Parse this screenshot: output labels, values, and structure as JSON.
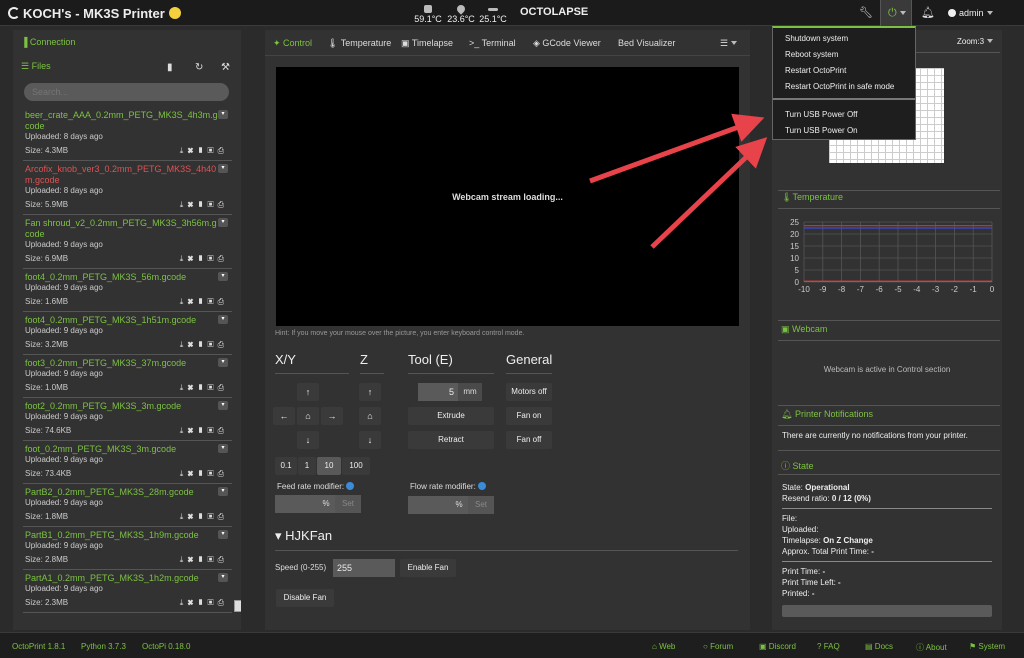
{
  "navbar": {
    "title": "KOCH's - MK3S Printer",
    "temps": [
      {
        "icon": "thermometer-icon",
        "value": "59.1°C"
      },
      {
        "icon": "droplet-icon",
        "value": "23.6°C"
      },
      {
        "icon": "bed-icon",
        "value": "25.1°C"
      }
    ],
    "octolapse": "OCTOLAPSE",
    "user": "admin",
    "icons": [
      "wrench-icon",
      "power-icon",
      "bell-icon",
      "user-icon"
    ]
  },
  "power_menu": {
    "items": [
      "Shutdown system",
      "Reboot system",
      "Restart OctoPrint",
      "Restart OctoPrint in safe mode",
      "Turn USB Power Off",
      "Turn USB Power On"
    ]
  },
  "sidebar": {
    "connection": "Connection",
    "files": "Files",
    "search_placeholder": "Search...",
    "file_list": [
      {
        "name": "beer_crate_AAA_0.2mm_PETG_MK3S_4h3m.gcode",
        "uploaded": "Uploaded: 8 days ago",
        "size": "Size: 4.3MB",
        "color": "#7cc242"
      },
      {
        "name": "Arcofix_knob_ver3_0.2mm_PETG_MK3S_4h40m.gcode",
        "uploaded": "Uploaded: 8 days ago",
        "size": "Size: 5.9MB",
        "color": "#e05252"
      },
      {
        "name": "Fan shroud_v2_0.2mm_PETG_MK3S_3h56m.gcode",
        "uploaded": "Uploaded: 9 days ago",
        "size": "Size: 6.9MB",
        "color": "#7cc242"
      },
      {
        "name": "foot4_0.2mm_PETG_MK3S_56m.gcode",
        "uploaded": "Uploaded: 9 days ago",
        "size": "Size: 1.6MB",
        "color": "#7cc242"
      },
      {
        "name": "foot4_0.2mm_PETG_MK3S_1h51m.gcode",
        "uploaded": "Uploaded: 9 days ago",
        "size": "Size: 3.2MB",
        "color": "#7cc242"
      },
      {
        "name": "foot3_0.2mm_PETG_MK3S_37m.gcode",
        "uploaded": "Uploaded: 9 days ago",
        "size": "Size: 1.0MB",
        "color": "#7cc242"
      },
      {
        "name": "foot2_0.2mm_PETG_MK3S_3m.gcode",
        "uploaded": "Uploaded: 9 days ago",
        "size": "Size: 74.6KB",
        "color": "#7cc242"
      },
      {
        "name": "foot_0.2mm_PETG_MK3S_3m.gcode",
        "uploaded": "Uploaded: 9 days ago",
        "size": "Size: 73.4KB",
        "color": "#7cc242"
      },
      {
        "name": "PartB2_0.2mm_PETG_MK3S_28m.gcode",
        "uploaded": "Uploaded: 9 days ago",
        "size": "Size: 1.8MB",
        "color": "#7cc242"
      },
      {
        "name": "PartB1_0.2mm_PETG_MK3S_1h9m.gcode",
        "uploaded": "Uploaded: 9 days ago",
        "size": "Size: 2.8MB",
        "color": "#7cc242"
      },
      {
        "name": "PartA1_0.2mm_PETG_MK3S_1h2m.gcode",
        "uploaded": "Uploaded: 9 days ago",
        "size": "Size: 2.3MB",
        "color": "#7cc242"
      }
    ]
  },
  "tabs": [
    "Control",
    "Temperature",
    "Timelapse",
    "Terminal",
    "GCode Viewer",
    "Bed Visualizer"
  ],
  "control": {
    "webcam_text": "Webcam stream loading...",
    "hint": "Hint: If you move your mouse over the picture, you enter keyboard control mode.",
    "sections": {
      "xy": "X/Y",
      "z": "Z",
      "tool": "Tool (E)",
      "general": "General"
    },
    "distances": [
      "0.1",
      "1",
      "10",
      "100"
    ],
    "selected_distance": "10",
    "extrude_amount": "5",
    "extrude_unit": "mm",
    "extrude": "Extrude",
    "retract": "Retract",
    "motors_off": "Motors off",
    "fan_on": "Fan on",
    "fan_off": "Fan off",
    "feed_rate": "Feed rate modifier:",
    "flow_rate": "Flow rate modifier:",
    "percent": "%",
    "set": "Set",
    "hjkfan": "HJKFan",
    "speed_label": "Speed (0-255)",
    "speed_value": "255",
    "enable_fan": "Enable Fan",
    "disable_fan": "Disable Fan"
  },
  "right": {
    "zoom": "Zoom:3",
    "temperature": "Temperature",
    "webcam": "Webcam",
    "webcam_info": "Webcam is active in Control section",
    "notifications": "Printer Notifications",
    "notif_text": "There are currently no notifications from your printer.",
    "state": "State",
    "state_label": "State:",
    "state_value": "Operational",
    "resend_label": "Resend ratio:",
    "resend_value": "0 / 12 (0%)",
    "file_label": "File:",
    "uploaded_label": "Uploaded:",
    "timelapse_label": "Timelapse:",
    "timelapse_value": "On Z Change",
    "approx_label": "Approx. Total Print Time:",
    "approx_value": "-",
    "print_time": "Print Time:",
    "print_time_value": "-",
    "print_time_left": "Print Time Left:",
    "print_time_left_value": "-",
    "printed": "Printed:",
    "printed_value": "-"
  },
  "chart_data": {
    "type": "line",
    "x_ticks": [
      "-10",
      "-9",
      "-8",
      "-7",
      "-6",
      "-5",
      "-4",
      "-3",
      "-2",
      "-1",
      "0"
    ],
    "y_ticks": [
      "25",
      "20",
      "15",
      "10",
      "5",
      "0"
    ],
    "ylim": [
      0,
      25
    ],
    "xlim": [
      -10,
      0
    ],
    "series": [
      {
        "color": "#3a4bd8",
        "values": [
          22.5,
          22.5,
          22.5,
          22.5,
          22.5,
          22.5,
          22.5,
          22.5,
          22.5,
          22.5,
          22.5
        ]
      },
      {
        "color": "#c0304a",
        "values": [
          23.5,
          23.5,
          23.5,
          23.5,
          23.5,
          23.5,
          23.5,
          23.5,
          23.5,
          23.5,
          23.5
        ]
      },
      {
        "color": "#e04040",
        "values": [
          0.3,
          0.3,
          0.3,
          0.3,
          0.3,
          0.3,
          0.3,
          0.3,
          0.3,
          0.3,
          0.3
        ]
      }
    ],
    "grid": true
  },
  "footer": {
    "left": [
      "OctoPrint 1.8.1",
      "Python 3.7.3",
      "OctoPi 0.18.0"
    ],
    "right": [
      "Web",
      "Forum",
      "Discord",
      "FAQ",
      "Docs",
      "About",
      "System"
    ]
  },
  "colors": {
    "accent": "#7cc242",
    "error": "#e05252",
    "arrow": "#e8434a"
  }
}
